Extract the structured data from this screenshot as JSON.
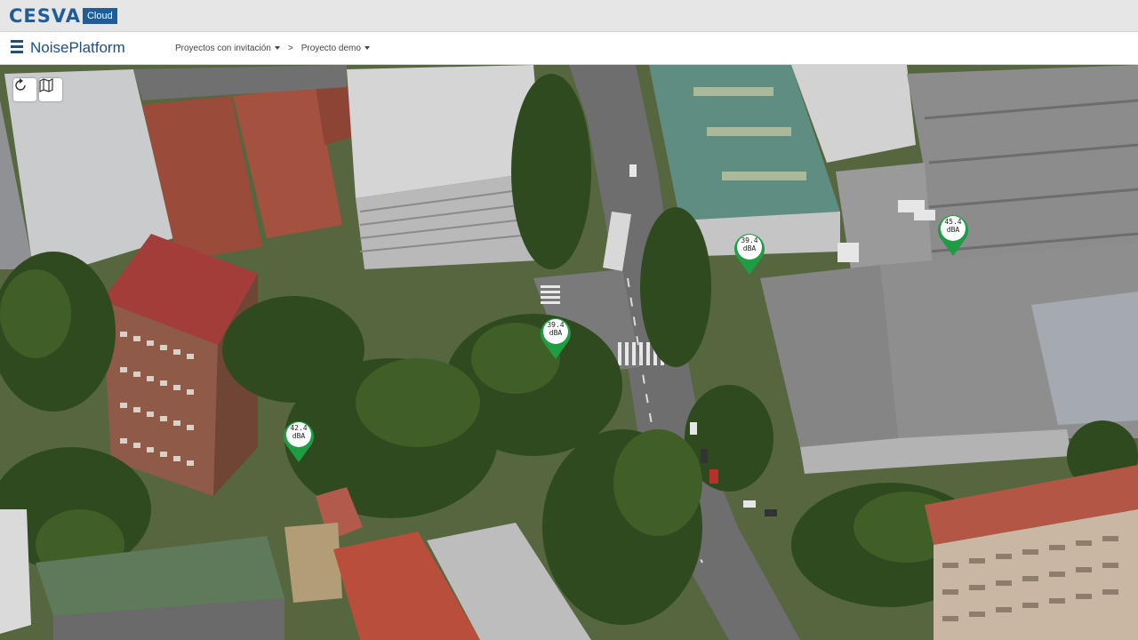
{
  "brand": {
    "name": "CESVA",
    "badge": "Cloud"
  },
  "header": {
    "app_title": "NoisePlatform",
    "breadcrumb": [
      "Proyectos con invitación",
      "Proyecto demo"
    ],
    "separator": ">"
  },
  "map": {
    "controls": [
      {
        "name": "reset-view",
        "icon": "rotate-icon"
      },
      {
        "name": "map-type",
        "icon": "folded-map-icon"
      }
    ],
    "sensors": [
      {
        "value": "42.4",
        "unit": "dBA"
      },
      {
        "value": "39.4",
        "unit": "dBA"
      },
      {
        "value": "39.4",
        "unit": "dBA"
      },
      {
        "value": "45.4",
        "unit": "dBA"
      }
    ]
  },
  "colors": {
    "brand_blue": "#1f5d99",
    "marker_green": "#1e9d43"
  }
}
